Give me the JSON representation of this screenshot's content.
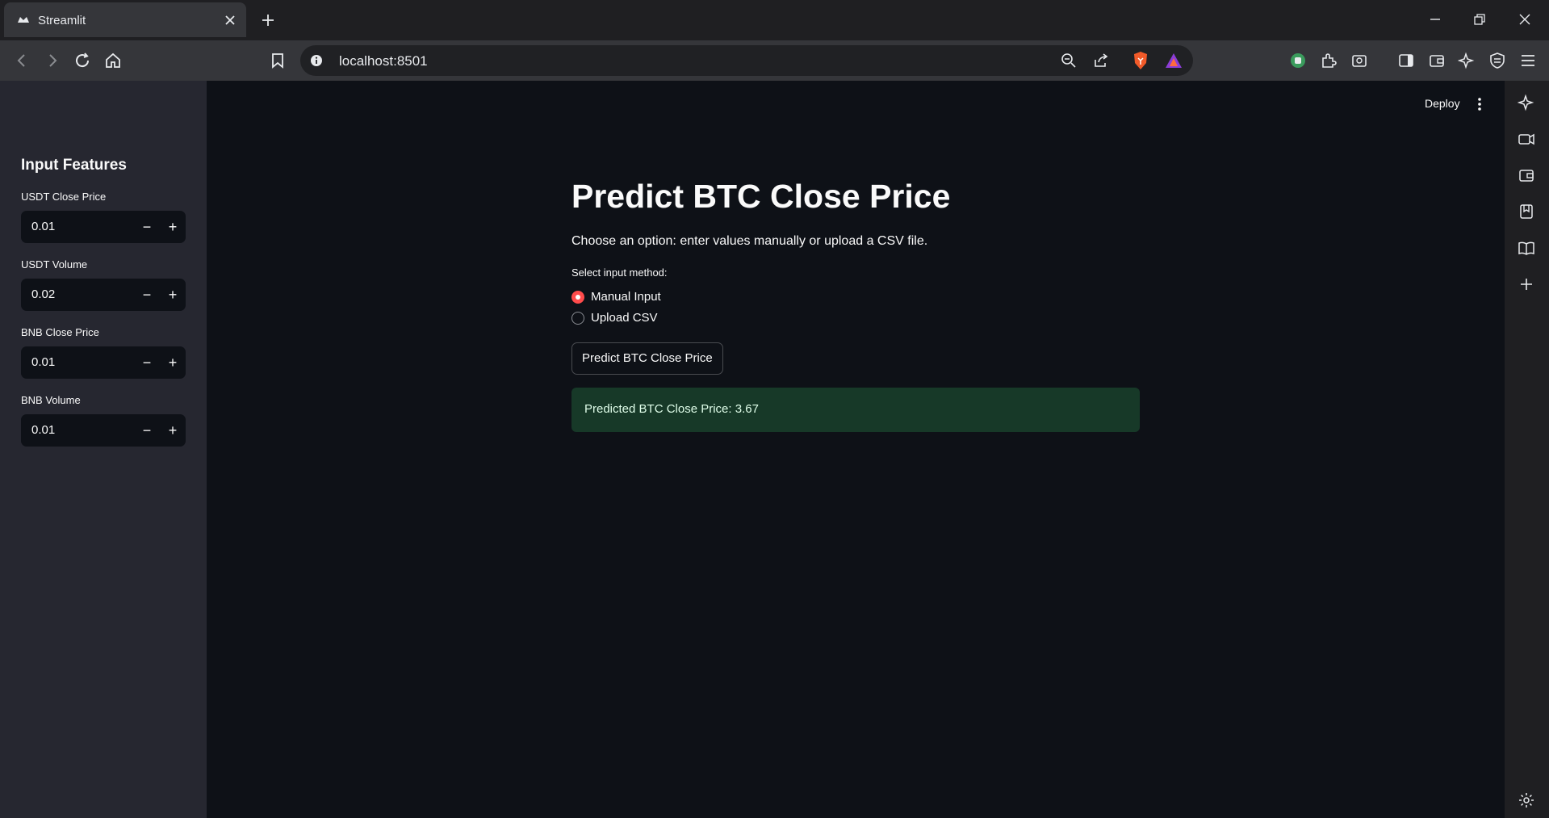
{
  "browser": {
    "tab_title": "Streamlit",
    "url": "localhost:8501"
  },
  "header": {
    "deploy_label": "Deploy"
  },
  "sidebar": {
    "title": "Input Features",
    "fields": [
      {
        "label": "USDT Close Price",
        "value": "0.01"
      },
      {
        "label": "USDT Volume",
        "value": "0.02"
      },
      {
        "label": "BNB Close Price",
        "value": "0.01"
      },
      {
        "label": "BNB Volume",
        "value": "0.01"
      }
    ],
    "minus_symbol": "−",
    "plus_symbol": "+"
  },
  "main": {
    "title": "Predict BTC Close Price",
    "description": "Choose an option: enter values manually or upload a CSV file.",
    "radio_label": "Select input method:",
    "radio_options": [
      {
        "label": "Manual Input",
        "selected": true
      },
      {
        "label": "Upload CSV",
        "selected": false
      }
    ],
    "predict_button": "Predict BTC Close Price",
    "result": "Predicted BTC Close Price: 3.67"
  },
  "colors": {
    "accent": "#ff4b4b",
    "success_bg": "#173928",
    "app_bg": "#0e1117",
    "sidebar_bg": "#262730"
  }
}
